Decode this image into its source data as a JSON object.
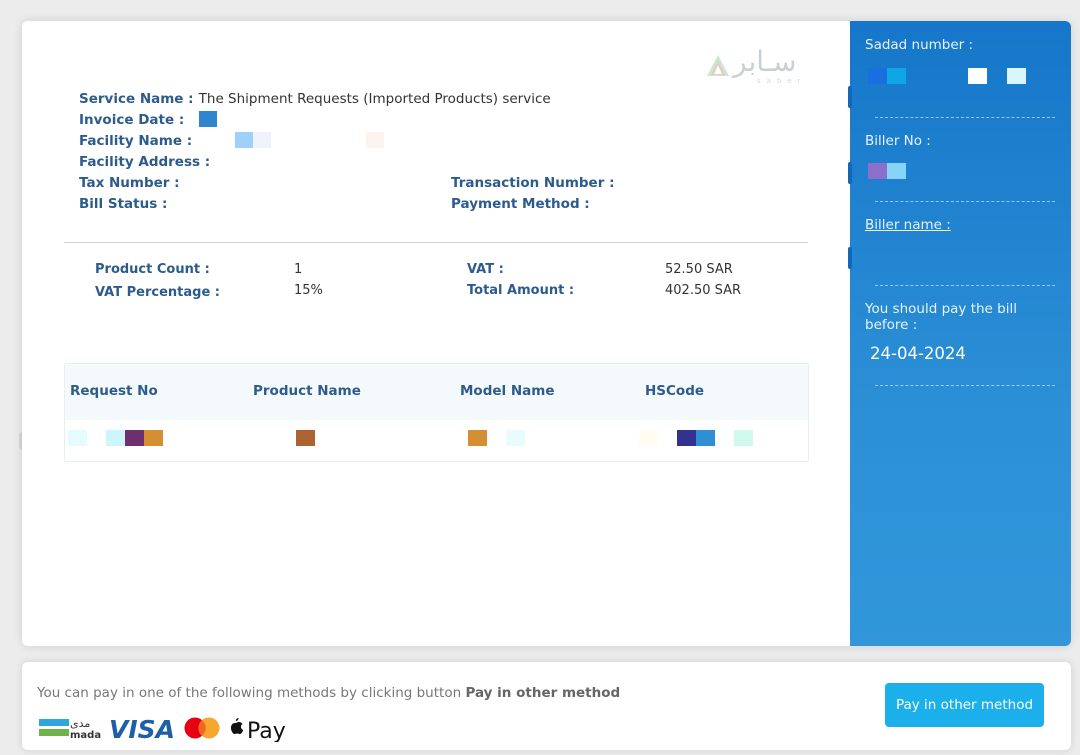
{
  "invoice": {
    "logo": {
      "arabic": "سـابر",
      "english": "saber"
    },
    "details": {
      "service_name_label": "Service Name :",
      "service_name_value": "The Shipment Requests (Imported Products) service",
      "invoice_date_label": "Invoice Date :",
      "facility_name_label": "Facility Name :",
      "facility_address_label": "Facility Address :",
      "tax_number_label": "Tax Number :",
      "bill_status_label": "Bill Status :",
      "transaction_number_label": "Transaction Number :",
      "payment_method_label": "Payment Method :"
    },
    "summary": {
      "product_count_label": "Product Count :",
      "product_count_value": "1",
      "vat_percentage_label": "VAT Percentage :",
      "vat_percentage_value": "15%",
      "vat_label": "VAT :",
      "vat_value": "52.50 SAR",
      "total_amount_label": "Total Amount :",
      "total_amount_value": "402.50 SAR"
    },
    "table": {
      "columns": [
        "Request No",
        "Product Name",
        "Model Name",
        "HSCode"
      ],
      "rows": [
        {
          "request_no": "[redacted]",
          "product_name": "[redacted]",
          "model_name": "[redacted]",
          "hscode": "[redacted]"
        }
      ]
    }
  },
  "sidebar": {
    "sadad_number_label": "Sadad number :",
    "biller_no_label": "Biller No :",
    "biller_name_label": "Biller name :",
    "pay_before_label": "You should pay the bill before :",
    "pay_before_date": "24-04-2024",
    "accent_color": "#1676c9"
  },
  "payment": {
    "instruction_prefix": "You can pay in one of the following methods by clicking button",
    "instruction_bold": "Pay in other method",
    "methods": [
      "mada",
      "VISA",
      "Mastercard",
      "Apple Pay"
    ],
    "mada_arabic": "مدى",
    "mada_latin": "mada",
    "visa_text": "VISA",
    "apple_pay_text": "Pay",
    "button_label": "Pay in other method",
    "button_color": "#1bb0ec"
  }
}
